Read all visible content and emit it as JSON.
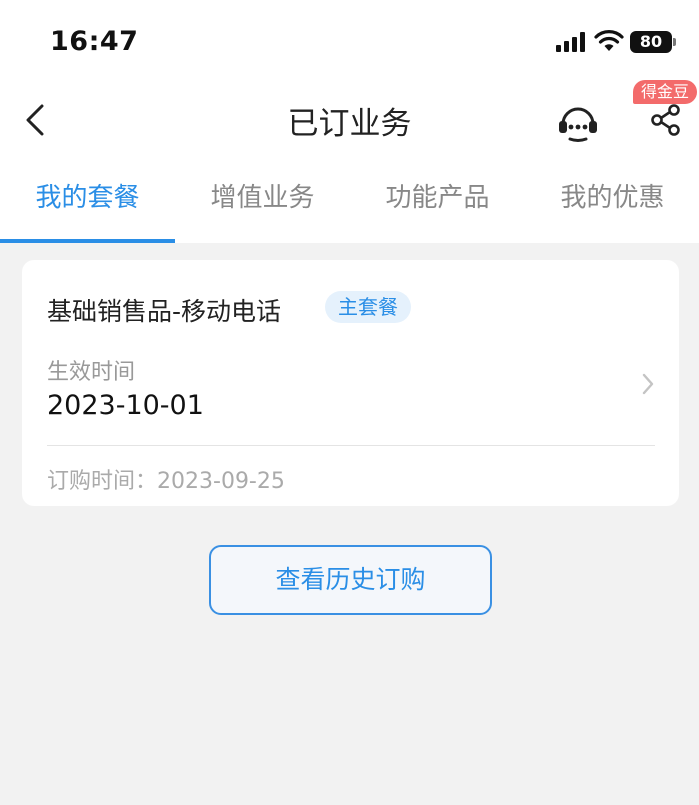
{
  "status_bar": {
    "time": "16:47",
    "battery": "80",
    "signal_icon": "cellular-signal-icon",
    "wifi_icon": "wifi-icon"
  },
  "nav": {
    "title": "已订业务",
    "back_icon": "chevron-left-icon",
    "service_icon": "customer-service-headset-icon",
    "share_icon": "share-icon",
    "coin_badge": "得金豆"
  },
  "tabs": [
    {
      "label": "我的套餐",
      "active": true
    },
    {
      "label": "增值业务",
      "active": false
    },
    {
      "label": "功能产品",
      "active": false
    },
    {
      "label": "我的优惠",
      "active": false
    }
  ],
  "card": {
    "name": "基础销售品-移动电话",
    "tag": "主套餐",
    "effective_label": "生效时间",
    "effective_date": "2023-10-01",
    "order_label": "订购时间：",
    "order_date": "2023-09-25"
  },
  "history_button": "查看历史订购",
  "colors": {
    "accent": "#2a8ee6",
    "badge": "#f36b6b",
    "background": "#f2f2f2"
  }
}
